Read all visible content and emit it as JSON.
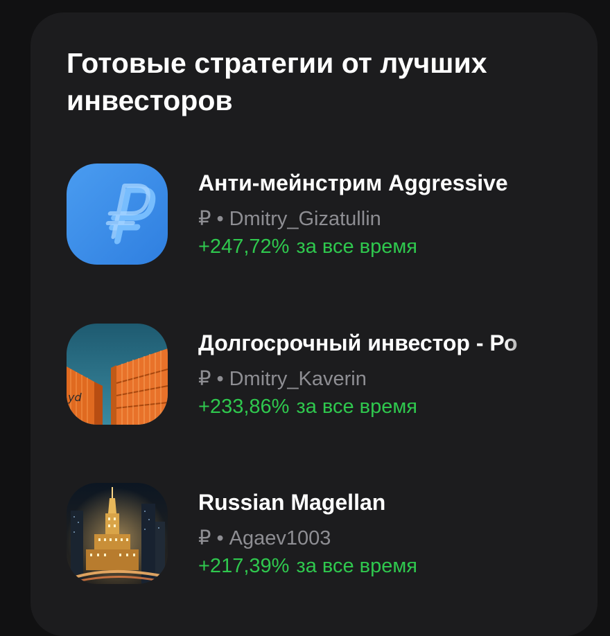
{
  "section": {
    "title": "Готовые стратегии от лучших инвесторов"
  },
  "strategies": [
    {
      "name": "Анти-мейнстрим Aggressive",
      "currency_symbol": "₽",
      "separator": "•",
      "author": "Dmitry_Gizatullin",
      "return_value": "+247,72%",
      "return_period": "за все время",
      "thumbnail_icon": "ruble-logo-icon"
    },
    {
      "name": "Долгосрочный инвестор - Ро",
      "currency_symbol": "₽",
      "separator": "•",
      "author": "Dmitry_Kaverin",
      "return_value": "+233,86%",
      "return_period": "за все время",
      "thumbnail_icon": "shipping-containers-image"
    },
    {
      "name": "Russian Magellan",
      "currency_symbol": "₽",
      "separator": "•",
      "author": "Agaev1003",
      "return_value": "+217,39%",
      "return_period": "за все время",
      "thumbnail_icon": "moscow-night-image"
    }
  ],
  "colors": {
    "background": "#111112",
    "card": "#1c1c1e",
    "text_primary": "#ffffff",
    "text_secondary": "#8e8e93",
    "positive": "#2fc84e",
    "accent_blue": "#3d8fe8"
  }
}
